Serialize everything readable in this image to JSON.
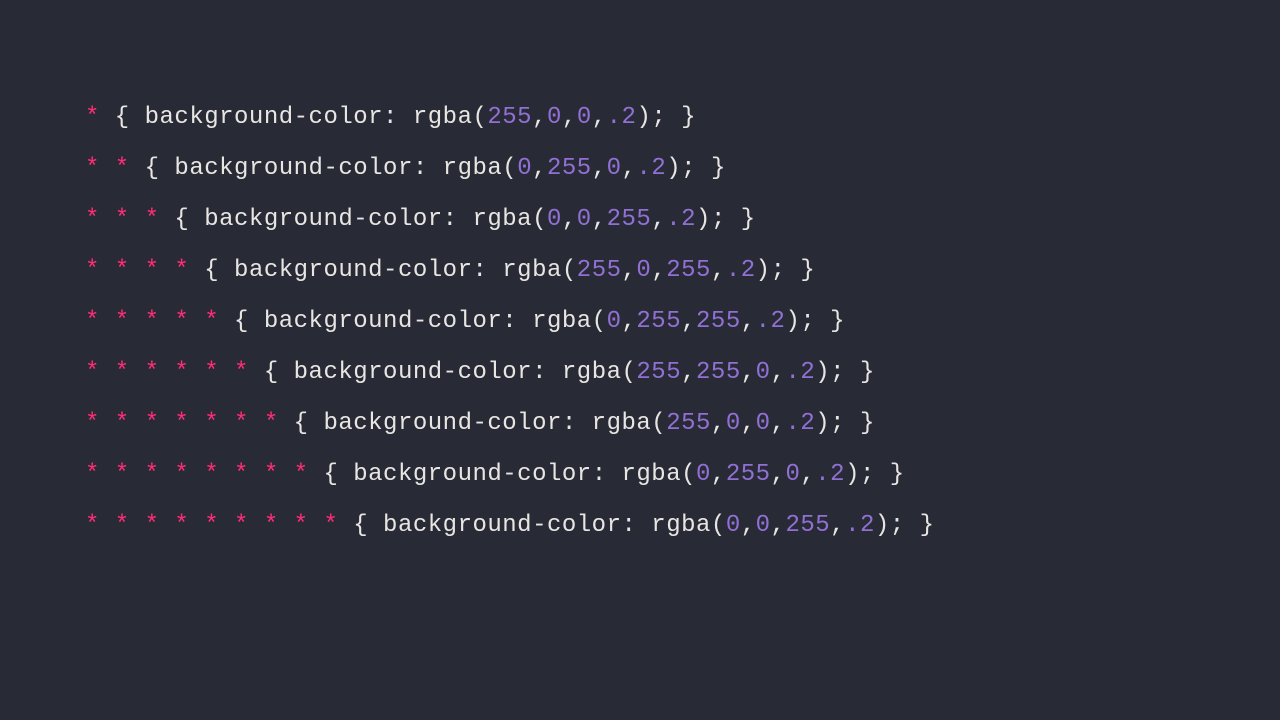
{
  "colors": {
    "background": "#282a36",
    "selector": "#ff2d75",
    "default": "#e8e6e3",
    "number": "#9170d4"
  },
  "code_lines": [
    {
      "tokens": [
        {
          "cls": "selector",
          "text": "*"
        },
        {
          "cls": "default",
          "text": " { background-color: rgba("
        },
        {
          "cls": "number",
          "text": "255"
        },
        {
          "cls": "default",
          "text": ","
        },
        {
          "cls": "number",
          "text": "0"
        },
        {
          "cls": "default",
          "text": ","
        },
        {
          "cls": "number",
          "text": "0"
        },
        {
          "cls": "default",
          "text": ","
        },
        {
          "cls": "number",
          "text": ".2"
        },
        {
          "cls": "default",
          "text": "); }"
        }
      ]
    },
    {
      "tokens": [
        {
          "cls": "selector",
          "text": "* *"
        },
        {
          "cls": "default",
          "text": " { background-color: rgba("
        },
        {
          "cls": "number",
          "text": "0"
        },
        {
          "cls": "default",
          "text": ","
        },
        {
          "cls": "number",
          "text": "255"
        },
        {
          "cls": "default",
          "text": ","
        },
        {
          "cls": "number",
          "text": "0"
        },
        {
          "cls": "default",
          "text": ","
        },
        {
          "cls": "number",
          "text": ".2"
        },
        {
          "cls": "default",
          "text": "); }"
        }
      ]
    },
    {
      "tokens": [
        {
          "cls": "selector",
          "text": "* * *"
        },
        {
          "cls": "default",
          "text": " { background-color: rgba("
        },
        {
          "cls": "number",
          "text": "0"
        },
        {
          "cls": "default",
          "text": ","
        },
        {
          "cls": "number",
          "text": "0"
        },
        {
          "cls": "default",
          "text": ","
        },
        {
          "cls": "number",
          "text": "255"
        },
        {
          "cls": "default",
          "text": ","
        },
        {
          "cls": "number",
          "text": ".2"
        },
        {
          "cls": "default",
          "text": "); }"
        }
      ]
    },
    {
      "tokens": [
        {
          "cls": "selector",
          "text": "* * * *"
        },
        {
          "cls": "default",
          "text": " { background-color: rgba("
        },
        {
          "cls": "number",
          "text": "255"
        },
        {
          "cls": "default",
          "text": ","
        },
        {
          "cls": "number",
          "text": "0"
        },
        {
          "cls": "default",
          "text": ","
        },
        {
          "cls": "number",
          "text": "255"
        },
        {
          "cls": "default",
          "text": ","
        },
        {
          "cls": "number",
          "text": ".2"
        },
        {
          "cls": "default",
          "text": "); }"
        }
      ]
    },
    {
      "tokens": [
        {
          "cls": "selector",
          "text": "* * * * *"
        },
        {
          "cls": "default",
          "text": " { background-color: rgba("
        },
        {
          "cls": "number",
          "text": "0"
        },
        {
          "cls": "default",
          "text": ","
        },
        {
          "cls": "number",
          "text": "255"
        },
        {
          "cls": "default",
          "text": ","
        },
        {
          "cls": "number",
          "text": "255"
        },
        {
          "cls": "default",
          "text": ","
        },
        {
          "cls": "number",
          "text": ".2"
        },
        {
          "cls": "default",
          "text": "); }"
        }
      ]
    },
    {
      "tokens": [
        {
          "cls": "selector",
          "text": "* * * * * *"
        },
        {
          "cls": "default",
          "text": " { background-color: rgba("
        },
        {
          "cls": "number",
          "text": "255"
        },
        {
          "cls": "default",
          "text": ","
        },
        {
          "cls": "number",
          "text": "255"
        },
        {
          "cls": "default",
          "text": ","
        },
        {
          "cls": "number",
          "text": "0"
        },
        {
          "cls": "default",
          "text": ","
        },
        {
          "cls": "number",
          "text": ".2"
        },
        {
          "cls": "default",
          "text": "); }"
        }
      ]
    },
    {
      "tokens": [
        {
          "cls": "selector",
          "text": "* * * * * * *"
        },
        {
          "cls": "default",
          "text": " { background-color: rgba("
        },
        {
          "cls": "number",
          "text": "255"
        },
        {
          "cls": "default",
          "text": ","
        },
        {
          "cls": "number",
          "text": "0"
        },
        {
          "cls": "default",
          "text": ","
        },
        {
          "cls": "number",
          "text": "0"
        },
        {
          "cls": "default",
          "text": ","
        },
        {
          "cls": "number",
          "text": ".2"
        },
        {
          "cls": "default",
          "text": "); }"
        }
      ]
    },
    {
      "tokens": [
        {
          "cls": "selector",
          "text": "* * * * * * * *"
        },
        {
          "cls": "default",
          "text": " { background-color: rgba("
        },
        {
          "cls": "number",
          "text": "0"
        },
        {
          "cls": "default",
          "text": ","
        },
        {
          "cls": "number",
          "text": "255"
        },
        {
          "cls": "default",
          "text": ","
        },
        {
          "cls": "number",
          "text": "0"
        },
        {
          "cls": "default",
          "text": ","
        },
        {
          "cls": "number",
          "text": ".2"
        },
        {
          "cls": "default",
          "text": "); }"
        }
      ]
    },
    {
      "tokens": [
        {
          "cls": "selector",
          "text": "* * * * * * * * *"
        },
        {
          "cls": "default",
          "text": " { background-color: rgba("
        },
        {
          "cls": "number",
          "text": "0"
        },
        {
          "cls": "default",
          "text": ","
        },
        {
          "cls": "number",
          "text": "0"
        },
        {
          "cls": "default",
          "text": ","
        },
        {
          "cls": "number",
          "text": "255"
        },
        {
          "cls": "default",
          "text": ","
        },
        {
          "cls": "number",
          "text": ".2"
        },
        {
          "cls": "default",
          "text": "); }"
        }
      ]
    }
  ]
}
